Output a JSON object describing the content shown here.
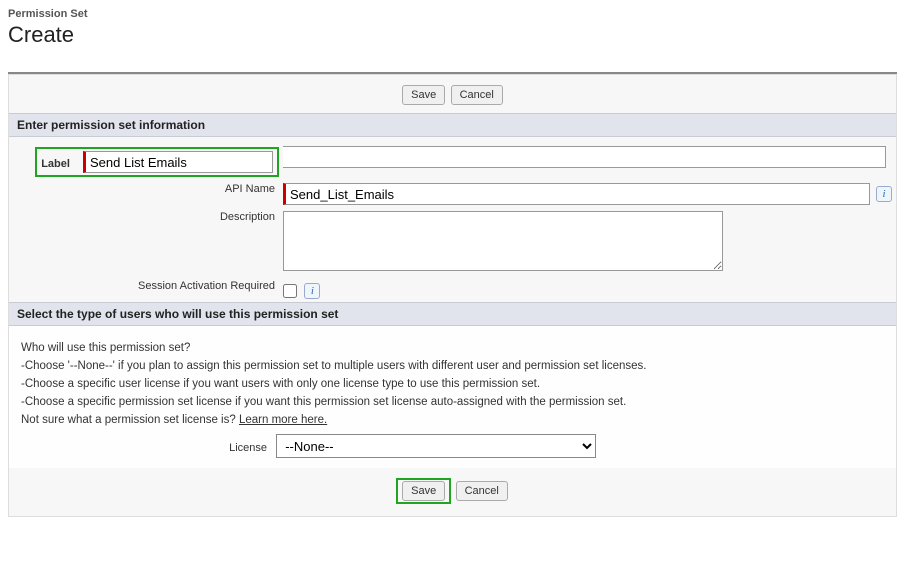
{
  "header": {
    "eyebrow": "Permission Set",
    "title": "Create"
  },
  "buttons": {
    "save": "Save",
    "cancel": "Cancel"
  },
  "section1": {
    "title": "Enter permission set information",
    "label_field": "Label",
    "label_value": "Send List Emails",
    "api_name_field": "API Name",
    "api_name_value": "Send_List_Emails",
    "description_field": "Description",
    "description_value": "",
    "session_activation_field": "Session Activation Required"
  },
  "section2": {
    "title": "Select the type of users who will use this permission set",
    "question": "Who will use this permission set?",
    "bullet1": "-Choose '--None--' if you plan to assign this permission set to multiple users with different user and permission set licenses.",
    "bullet2": "-Choose a specific user license if you want users with only one license type to use this permission set.",
    "bullet3": "-Choose a specific permission set license if you want this permission set license auto-assigned with the permission set.",
    "not_sure": "Not sure what a permission set license is? ",
    "learn_more": "Learn more here.",
    "license_label": "License",
    "license_value": "--None--"
  },
  "info_glyph": "i"
}
